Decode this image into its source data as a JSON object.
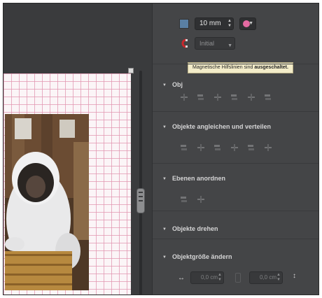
{
  "toolbar": {
    "fill_color": "#5a7fa3",
    "stroke_width_value": "10 mm",
    "stroke_color": "#e56aa2",
    "magnet_icon": "magnet-icon",
    "blend_select_value": "Initial"
  },
  "tooltip": {
    "text_prefix": "Magnetische Hilfslinien sind ",
    "text_bold": "ausgeschaltet."
  },
  "sections": {
    "align_partial": "Obj",
    "align_distribute": "Objekte angleichen und verteilen",
    "layers": "Ebenen anordnen",
    "rotate": "Objekte drehen",
    "resize": "Objektgröße ändern"
  },
  "resize": {
    "width_value": "0,0 cm",
    "height_value": "0,0 cm"
  },
  "canvas": {
    "grid_color": "#e296b0",
    "page_color": "#fbf5f7"
  }
}
